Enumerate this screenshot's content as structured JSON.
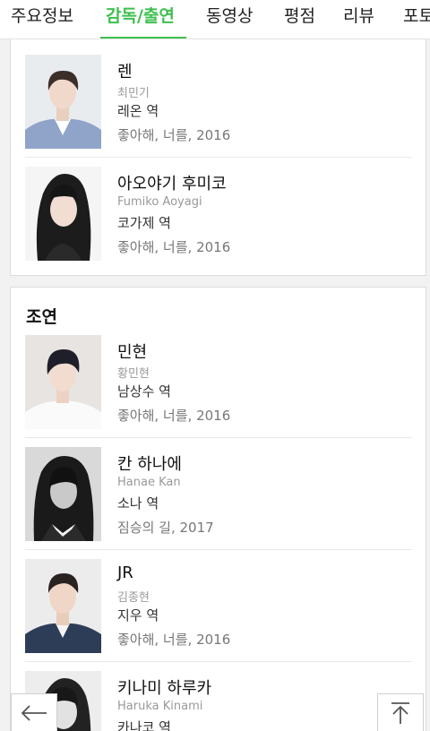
{
  "tabs": [
    {
      "label": "주요정보"
    },
    {
      "label": "감독/출연"
    },
    {
      "label": "동영상"
    },
    {
      "label": "평점"
    },
    {
      "label": "리뷰"
    },
    {
      "label": "포토"
    }
  ],
  "accent_color": "#3fbf4f",
  "lead_cast": [
    {
      "name": "렌",
      "original_name": "최민기",
      "role": "레온 역",
      "work": "좋아해, 너를, 2016"
    },
    {
      "name": "아오야기 후미코",
      "original_name": "Fumiko Aoyagi",
      "role": "코가제 역",
      "work": "좋아해, 너를, 2016"
    }
  ],
  "supporting": {
    "title": "조연",
    "cast": [
      {
        "name": "민현",
        "original_name": "황민현",
        "role": "남상수 역",
        "work": "좋아해, 너를, 2016"
      },
      {
        "name": "칸 하나에",
        "original_name": "Hanae Kan",
        "role": "소나 역",
        "work": "짐승의 길, 2017"
      },
      {
        "name": "JR",
        "original_name": "김종현",
        "role": "지우 역",
        "work": "좋아해, 너를, 2016"
      },
      {
        "name": "키나미 하루카",
        "original_name": "Haruka Kinami",
        "role": "카나코 역",
        "work": ""
      }
    ]
  },
  "icons": {
    "back": "arrow-left-icon",
    "top": "arrow-up-to-top-icon"
  }
}
